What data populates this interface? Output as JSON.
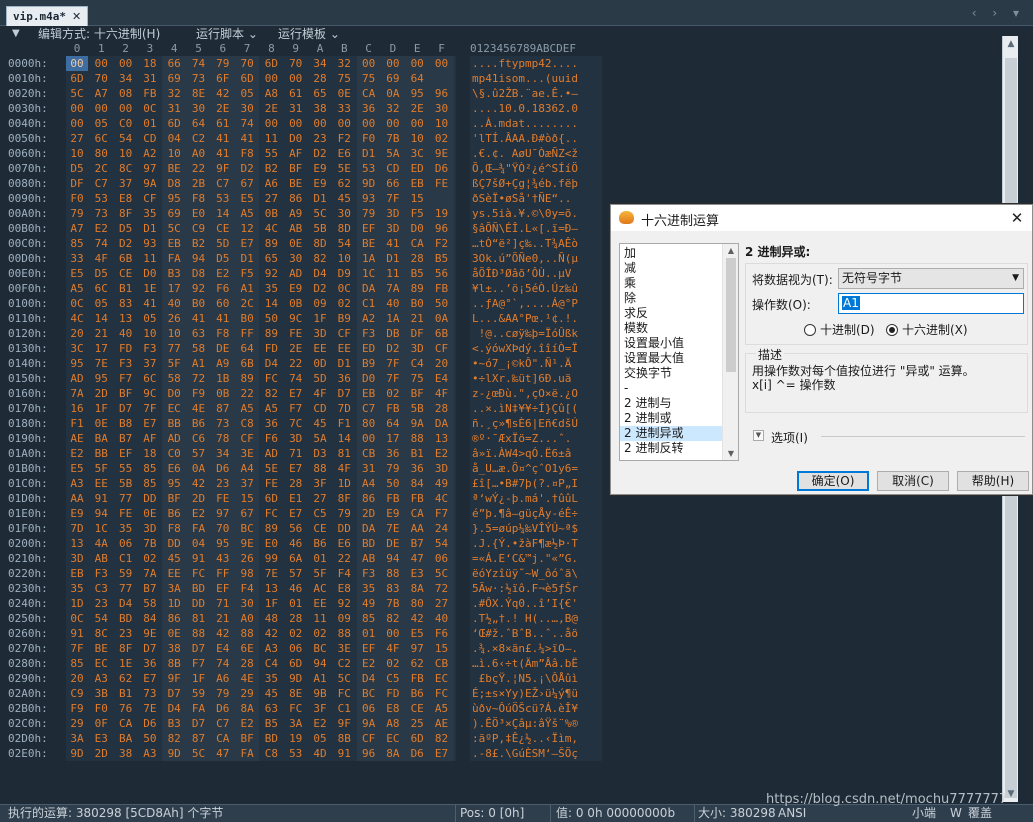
{
  "tab": {
    "filename": "vip.m4a*",
    "close": "✕"
  },
  "tabnav": "‹ › ▾",
  "toolbar": {
    "pin": "▼",
    "edit_mode": "编辑方式: 十六进制(H)",
    "run_script": "运行脚本",
    "run_template": "运行模板"
  },
  "editor": {
    "col_headers": [
      "0",
      "1",
      "2",
      "3",
      "4",
      "5",
      "6",
      "7",
      "8",
      "9",
      "A",
      "B",
      "C",
      "D",
      "E",
      "F"
    ],
    "ascii_header": "0123456789ABCDEF",
    "rows": [
      {
        "addr": "0000h:",
        "hex": [
          "00",
          "00",
          "00",
          "18",
          "66",
          "74",
          "79",
          "70",
          "6D",
          "70",
          "34",
          "32",
          "00",
          "00",
          "00",
          "00"
        ],
        "ascii": "....ftypmp42...."
      },
      {
        "addr": "0010h:",
        "hex": [
          "6D",
          "70",
          "34",
          "31",
          "69",
          "73",
          "6F",
          "6D",
          "00",
          "00",
          "28",
          "75",
          "75",
          "69",
          "64"
        ],
        "ascii": "mp41isom...(uuid"
      },
      {
        "addr": "0020h:",
        "hex": [
          "5C",
          "A7",
          "08",
          "FB",
          "32",
          "8E",
          "42",
          "05",
          "A8",
          "61",
          "65",
          "0E",
          "CA",
          "0A",
          "95",
          "96"
        ],
        "ascii": "\\§.û2ŽB.¨ae.Ê.•–"
      },
      {
        "addr": "0030h:",
        "hex": [
          "00",
          "00",
          "00",
          "0C",
          "31",
          "30",
          "2E",
          "30",
          "2E",
          "31",
          "38",
          "33",
          "36",
          "32",
          "2E",
          "30"
        ],
        "ascii": "....10.0.18362.0"
      },
      {
        "addr": "0040h:",
        "hex": [
          "00",
          "05",
          "C0",
          "01",
          "6D",
          "64",
          "61",
          "74",
          "00",
          "00",
          "00",
          "00",
          "00",
          "00",
          "00",
          "10"
        ],
        "ascii": "..À.mdat........"
      },
      {
        "addr": "0050h:",
        "hex": [
          "27",
          "6C",
          "54",
          "CD",
          "04",
          "C2",
          "41",
          "41",
          "11",
          "D0",
          "23",
          "F2",
          "F0",
          "7B",
          "10",
          "02"
        ],
        "ascii": "'lTÍ.ÂAA.Ð#òð{.."
      },
      {
        "addr": "0060h:",
        "hex": [
          "10",
          "80",
          "10",
          "A2",
          "10",
          "A0",
          "41",
          "F8",
          "55",
          "AF",
          "D2",
          "E6",
          "D1",
          "5A",
          "3C",
          "9E"
        ],
        "ascii": ".€.¢. AøU¯ÒæÑZ<ž"
      },
      {
        "addr": "0070h:",
        "hex": [
          "D5",
          "2C",
          "8C",
          "97",
          "BE",
          "22",
          "9F",
          "D2",
          "B2",
          "BF",
          "E9",
          "5E",
          "53",
          "CD",
          "ED",
          "D6"
        ],
        "ascii": "Õ,Œ—¾\"ŸÒ²¿é^SÍíÖ"
      },
      {
        "addr": "0080h:",
        "hex": [
          "DF",
          "C7",
          "37",
          "9A",
          "D8",
          "2B",
          "C7",
          "67",
          "A6",
          "BE",
          "E9",
          "62",
          "9D",
          "66",
          "EB",
          "FE"
        ],
        "ascii": "ßÇ7šØ+Çg¦¾éb.fëþ"
      },
      {
        "addr": "0090h:",
        "hex": [
          "F0",
          "53",
          "E8",
          "CF",
          "95",
          "F8",
          "53",
          "E5",
          "27",
          "86",
          "D1",
          "45",
          "93",
          "7F",
          "15"
        ],
        "ascii": "ðSèÏ•øSå'†ÑE“.."
      },
      {
        "addr": "00A0h:",
        "hex": [
          "79",
          "73",
          "8F",
          "35",
          "69",
          "E0",
          "14",
          "A5",
          "0B",
          "A9",
          "5C",
          "30",
          "79",
          "3D",
          "F5",
          "19"
        ],
        "ascii": "ys.5ià.¥.©\\0y=õ."
      },
      {
        "addr": "00B0h:",
        "hex": [
          "A7",
          "E2",
          "D5",
          "D1",
          "5C",
          "C9",
          "CE",
          "12",
          "4C",
          "AB",
          "5B",
          "8D",
          "EF",
          "3D",
          "D0",
          "96"
        ],
        "ascii": "§âÕÑ\\ÉÎ.L«[.ï=Ð–"
      },
      {
        "addr": "00C0h:",
        "hex": [
          "85",
          "74",
          "D2",
          "93",
          "EB",
          "B2",
          "5D",
          "E7",
          "89",
          "0E",
          "8D",
          "54",
          "BE",
          "41",
          "CA",
          "F2"
        ],
        "ascii": "…tÒ“ë²]ç‰..T¾AÊò"
      },
      {
        "addr": "00D0h:",
        "hex": [
          "33",
          "4F",
          "6B",
          "11",
          "FA",
          "94",
          "D5",
          "D1",
          "65",
          "30",
          "82",
          "10",
          "1A",
          "D1",
          "28",
          "B5"
        ],
        "ascii": "3Ok.ú”ÕÑe0‚..Ñ(µ"
      },
      {
        "addr": "00E0h:",
        "hex": [
          "E5",
          "D5",
          "CE",
          "D0",
          "B3",
          "D8",
          "E2",
          "F5",
          "92",
          "AD",
          "D4",
          "D9",
          "1C",
          "11",
          "B5",
          "56"
        ],
        "ascii": "åÕÎÐ³Øâõ’­ÔÙ..µV"
      },
      {
        "addr": "00F0h:",
        "hex": [
          "A5",
          "6C",
          "B1",
          "1E",
          "17",
          "92",
          "F6",
          "A1",
          "35",
          "E9",
          "D2",
          "0C",
          "DA",
          "7A",
          "89",
          "FB"
        ],
        "ascii": "¥l±..’ö¡5éÒ.Úz‰û"
      },
      {
        "addr": "0100h:",
        "hex": [
          "0C",
          "05",
          "83",
          "41",
          "40",
          "B0",
          "60",
          "2C",
          "14",
          "0B",
          "09",
          "02",
          "C1",
          "40",
          "B0",
          "50"
        ],
        "ascii": "..ƒA@°`,....Á@°P"
      },
      {
        "addr": "0110h:",
        "hex": [
          "4C",
          "14",
          "13",
          "05",
          "26",
          "41",
          "41",
          "B0",
          "50",
          "9C",
          "1F",
          "B9",
          "A2",
          "1A",
          "21",
          "0A"
        ],
        "ascii": "L...&AA°Pœ.¹¢.!."
      },
      {
        "addr": "0120h:",
        "hex": [
          "20",
          "21",
          "40",
          "10",
          "10",
          "63",
          "F8",
          "FF",
          "89",
          "FE",
          "3D",
          "CF",
          "F3",
          "DB",
          "DF",
          "6B"
        ],
        "ascii": " !@..cøÿ‰þ=ÏóÛßk"
      },
      {
        "addr": "0130h:",
        "hex": [
          "3C",
          "17",
          "FD",
          "F3",
          "77",
          "58",
          "DE",
          "64",
          "FD",
          "2E",
          "EE",
          "EE",
          "ED",
          "D2",
          "3D",
          "CF"
        ],
        "ascii": "<.ýówXÞdý.îîíÒ=Ï"
      },
      {
        "addr": "0140h:",
        "hex": [
          "95",
          "7E",
          "F3",
          "37",
          "5F",
          "A1",
          "A9",
          "6B",
          "D4",
          "22",
          "0D",
          "D1",
          "B9",
          "7F",
          "C4",
          "20"
        ],
        "ascii": "•~ó7_¡©kÔ\".Ñ¹.Ä "
      },
      {
        "addr": "0150h:",
        "hex": [
          "AD",
          "95",
          "F7",
          "6C",
          "58",
          "72",
          "1B",
          "89",
          "FC",
          "74",
          "5D",
          "36",
          "D0",
          "7F",
          "75",
          "E4"
        ],
        "ascii": "­•÷lXr.‰üt]6Ð.uä"
      },
      {
        "addr": "0160h:",
        "hex": [
          "7A",
          "2D",
          "BF",
          "9C",
          "D0",
          "F9",
          "0B",
          "22",
          "82",
          "E7",
          "4F",
          "D7",
          "EB",
          "02",
          "BF",
          "4F"
        ],
        "ascii": "z-¿œÐù.\"‚çO×ë.¿O"
      },
      {
        "addr": "0170h:",
        "hex": [
          "16",
          "1F",
          "D7",
          "7F",
          "EC",
          "4E",
          "87",
          "A5",
          "A5",
          "F7",
          "CD",
          "7D",
          "C7",
          "FB",
          "5B",
          "28"
        ],
        "ascii": "..×.ìN‡¥¥÷Í}Çû[("
      },
      {
        "addr": "0180h:",
        "hex": [
          "F1",
          "0E",
          "B8",
          "E7",
          "BB",
          "B6",
          "73",
          "C8",
          "36",
          "7C",
          "45",
          "F1",
          "80",
          "64",
          "9A",
          "DA"
        ],
        "ascii": "ñ.¸ç»¶sÈ6|Eñ€dšÚ"
      },
      {
        "addr": "0190h:",
        "hex": [
          "AE",
          "BA",
          "B7",
          "AF",
          "AD",
          "C6",
          "78",
          "CF",
          "F6",
          "3D",
          "5A",
          "14",
          "00",
          "17",
          "88",
          "13"
        ],
        "ascii": "®º·¯­ÆxÏö=Z...ˆ."
      },
      {
        "addr": "01A0h:",
        "hex": [
          "E2",
          "BB",
          "EF",
          "18",
          "C0",
          "57",
          "34",
          "3E",
          "AD",
          "71",
          "D3",
          "81",
          "CB",
          "36",
          "B1",
          "E2"
        ],
        "ascii": "â»ï.ÀW4>­qÓ.Ë6±â"
      },
      {
        "addr": "01B0h:",
        "hex": [
          "E5",
          "5F",
          "55",
          "85",
          "E6",
          "0A",
          "D6",
          "A4",
          "5E",
          "E7",
          "88",
          "4F",
          "31",
          "79",
          "36",
          "3D"
        ],
        "ascii": "å_U…æ.Ö¤^çˆO1y6="
      },
      {
        "addr": "01C0h:",
        "hex": [
          "A3",
          "EE",
          "5B",
          "85",
          "95",
          "42",
          "23",
          "37",
          "FE",
          "28",
          "3F",
          "1D",
          "A4",
          "50",
          "84",
          "49"
        ],
        "ascii": "£î[…•B#7þ(?.¤P„I"
      },
      {
        "addr": "01D0h:",
        "hex": [
          "AA",
          "91",
          "77",
          "DD",
          "BF",
          "2D",
          "FE",
          "15",
          "6D",
          "E1",
          "27",
          "8F",
          "86",
          "FB",
          "FB",
          "4C"
        ],
        "ascii": "ª‘wÝ¿-þ.má'.†ûûL"
      },
      {
        "addr": "01E0h:",
        "hex": [
          "E9",
          "94",
          "FE",
          "0E",
          "B6",
          "E2",
          "97",
          "67",
          "FC",
          "E7",
          "C5",
          "79",
          "2D",
          "E9",
          "CA",
          "F7"
        ],
        "ascii": "é”þ.¶â—güçÅy-éÊ÷"
      },
      {
        "addr": "01F0h:",
        "hex": [
          "7D",
          "1C",
          "35",
          "3D",
          "F8",
          "FA",
          "70",
          "BC",
          "89",
          "56",
          "CE",
          "DD",
          "DA",
          "7E",
          "AA",
          "24"
        ],
        "ascii": "}.5=øúp¼‰VÎÝÚ~ª$"
      },
      {
        "addr": "0200h:",
        "hex": [
          "13",
          "4A",
          "06",
          "7B",
          "DD",
          "04",
          "95",
          "9E",
          "E0",
          "46",
          "B6",
          "E6",
          "BD",
          "DE",
          "B7",
          "54"
        ],
        "ascii": ".J.{Ý.•žàF¶æ½Þ·T"
      },
      {
        "addr": "0210h:",
        "hex": [
          "3D",
          "AB",
          "C1",
          "02",
          "45",
          "91",
          "43",
          "26",
          "99",
          "6A",
          "01",
          "22",
          "AB",
          "94",
          "47",
          "06"
        ],
        "ascii": "=«Á.E‘C&™j.\"«”G."
      },
      {
        "addr": "0220h:",
        "hex": [
          "EB",
          "F3",
          "59",
          "7A",
          "EE",
          "FC",
          "FF",
          "98",
          "7E",
          "57",
          "5F",
          "F4",
          "F3",
          "88",
          "E3",
          "5C"
        ],
        "ascii": "ëóYzîüÿ˜~W_ôóˆã\\"
      },
      {
        "addr": "0230h:",
        "hex": [
          "35",
          "C3",
          "77",
          "B7",
          "3A",
          "BD",
          "EF",
          "F4",
          "13",
          "46",
          "AC",
          "E8",
          "35",
          "83",
          "8A",
          "72"
        ],
        "ascii": "5Ãw·:½ïô.F¬è5ƒŠr"
      },
      {
        "addr": "0240h:",
        "hex": [
          "1D",
          "23",
          "D4",
          "58",
          "1D",
          "DD",
          "71",
          "30",
          "1F",
          "01",
          "EE",
          "92",
          "49",
          "7B",
          "80",
          "27"
        ],
        "ascii": ".#ÔX.Ýq0..î’I{€'"
      },
      {
        "addr": "0250h:",
        "hex": [
          "0C",
          "54",
          "BD",
          "84",
          "86",
          "81",
          "21",
          "A0",
          "48",
          "28",
          "11",
          "09",
          "85",
          "82",
          "42",
          "40"
        ],
        "ascii": ".T½„†.! H(..…‚B@"
      },
      {
        "addr": "0260h:",
        "hex": [
          "91",
          "8C",
          "23",
          "9E",
          "0E",
          "88",
          "42",
          "88",
          "42",
          "02",
          "02",
          "88",
          "01",
          "00",
          "E5",
          "F6"
        ],
        "ascii": "‘Œ#ž.ˆBˆB..ˆ..åö"
      },
      {
        "addr": "0270h:",
        "hex": [
          "7F",
          "BE",
          "8F",
          "D7",
          "38",
          "D7",
          "E4",
          "6E",
          "A3",
          "06",
          "BC",
          "3E",
          "EF",
          "4F",
          "97",
          "15"
        ],
        "ascii": ".¾.×8×än£.¼>ïO—."
      },
      {
        "addr": "0280h:",
        "hex": [
          "85",
          "EC",
          "1E",
          "36",
          "8B",
          "F7",
          "74",
          "28",
          "C4",
          "6D",
          "94",
          "C2",
          "E2",
          "02",
          "62",
          "CB"
        ],
        "ascii": "…ì.6‹÷t(Äm”Ââ.bË"
      },
      {
        "addr": "0290h:",
        "hex": [
          "20",
          "A3",
          "62",
          "E7",
          "9F",
          "1F",
          "A6",
          "4E",
          "35",
          "9D",
          "A1",
          "5C",
          "D4",
          "C5",
          "FB",
          "EC"
        ],
        "ascii": " £bçŸ.¦N5.¡\\ÔÅûì"
      },
      {
        "addr": "02A0h:",
        "hex": [
          "C9",
          "3B",
          "B1",
          "73",
          "D7",
          "59",
          "79",
          "29",
          "45",
          "8E",
          "9B",
          "FC",
          "BC",
          "FD",
          "B6",
          "FC"
        ],
        "ascii": "É;±s×Yy)EŽ›ü¼ý¶ü"
      },
      {
        "addr": "02B0h:",
        "hex": [
          "F9",
          "F0",
          "76",
          "7E",
          "D4",
          "FA",
          "D6",
          "8A",
          "63",
          "FC",
          "3F",
          "C1",
          "06",
          "E8",
          "CE",
          "A5"
        ],
        "ascii": "ùðv~ÔúÖŠcü?Á.èÎ¥"
      },
      {
        "addr": "02C0h:",
        "hex": [
          "29",
          "0F",
          "CA",
          "D6",
          "B3",
          "D7",
          "C7",
          "E2",
          "B5",
          "3A",
          "E2",
          "9F",
          "9A",
          "A8",
          "25",
          "AE"
        ],
        "ascii": ").ÊÖ³×Çâµ:âŸš¨%®"
      },
      {
        "addr": "02D0h:",
        "hex": [
          "3A",
          "E3",
          "BA",
          "50",
          "82",
          "87",
          "CA",
          "BF",
          "BD",
          "19",
          "05",
          "8B",
          "CF",
          "EC",
          "6D",
          "82"
        ],
        "ascii": ":ãºP‚‡Ê¿½..‹Ïìm‚"
      },
      {
        "addr": "02E0h:",
        "hex": [
          "9D",
          "2D",
          "38",
          "A3",
          "9D",
          "5C",
          "47",
          "FA",
          "C8",
          "53",
          "4D",
          "91",
          "96",
          "8A",
          "D6",
          "E7"
        ],
        "ascii": ".-8£.\\GúÈSM‘–ŠÖç"
      }
    ]
  },
  "statusbar": {
    "run_op": "执行的运算: 380298 [5CD8Ah] 个字节",
    "pos": "Pos: 0 [0h]",
    "value": "值: 0 0h 00000000b",
    "size": "大小: 380298",
    "encoding": "ANSI",
    "endian": "小端",
    "w": "W",
    "overwrite": "覆盖"
  },
  "watermark": "https://blog.csdn.net/mochu7777777",
  "dialog": {
    "title": "十六进制运算",
    "close": "✕",
    "operations": [
      "加",
      "减",
      "乘",
      "除",
      "求反",
      "模数",
      "设置最小值",
      "设置最大值",
      "交换字节",
      "-",
      "2 进制与",
      "2 进制或",
      "2 进制异或",
      "2 进制反转"
    ],
    "selected_index": 12,
    "heading": "2 进制异或:",
    "treat_as_label": "将数据视为(T):",
    "treat_as_value": "无符号字节",
    "operand_label": "操作数(O):",
    "operand_value": "A1",
    "radio_decimal": "十进制(D)",
    "radio_hex": "十六进制(X)",
    "desc_title": "描述",
    "desc_text": "用操作数对每个值按位进行 \"异或\" 运算。\nx[i] ^= 操作数",
    "options_label": "选项(I)",
    "btn_ok": "确定(O)",
    "btn_cancel": "取消(C)",
    "btn_help": "帮助(H)"
  }
}
